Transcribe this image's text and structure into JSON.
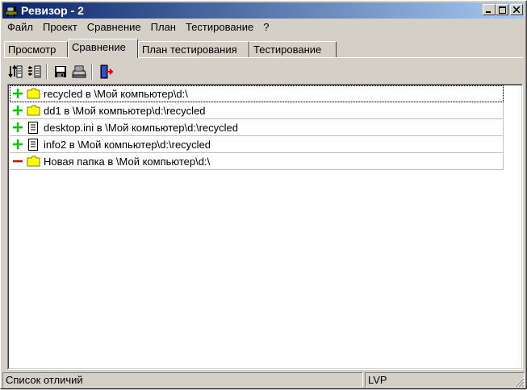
{
  "window": {
    "title": "Ревизор - 2"
  },
  "caption_buttons": {
    "minimize": "_",
    "maximize": "□",
    "close": "×"
  },
  "menu": [
    "Файл",
    "Проект",
    "Сравнение",
    "План",
    "Тестирование",
    "?"
  ],
  "tabs": [
    {
      "label": "Просмотр",
      "active": false
    },
    {
      "label": "Сравнение",
      "active": true
    },
    {
      "label": "План тестирования",
      "active": false
    },
    {
      "label": "Тестирование",
      "active": false
    }
  ],
  "toolbar": {
    "buttons": [
      {
        "icon": "compare-columns-icon"
      },
      {
        "icon": "compare-list-icon"
      },
      {
        "icon": "save-icon"
      },
      {
        "icon": "print-icon"
      },
      {
        "icon": "exit-icon"
      }
    ]
  },
  "diff_list": [
    {
      "status": "added",
      "type": "folder",
      "text": "recycled в \\Мой компьютер\\d:\\"
    },
    {
      "status": "added",
      "type": "folder",
      "text": "dd1 в \\Мой компьютер\\d:\\recycled"
    },
    {
      "status": "added",
      "type": "file",
      "text": "desktop.ini в \\Мой компьютер\\d:\\recycled"
    },
    {
      "status": "added",
      "type": "file",
      "text": "info2 в \\Мой компьютер\\d:\\recycled"
    },
    {
      "status": "removed",
      "type": "folder",
      "text": "Новая папка в \\Мой компьютер\\d:\\"
    }
  ],
  "statusbar": {
    "left": "Список отличий",
    "right": "LVP"
  },
  "colors": {
    "added": "#00cc00",
    "removed": "#e00000",
    "folder": "#ffff00",
    "title_start": "#0a246a",
    "title_end": "#a6caf0"
  }
}
